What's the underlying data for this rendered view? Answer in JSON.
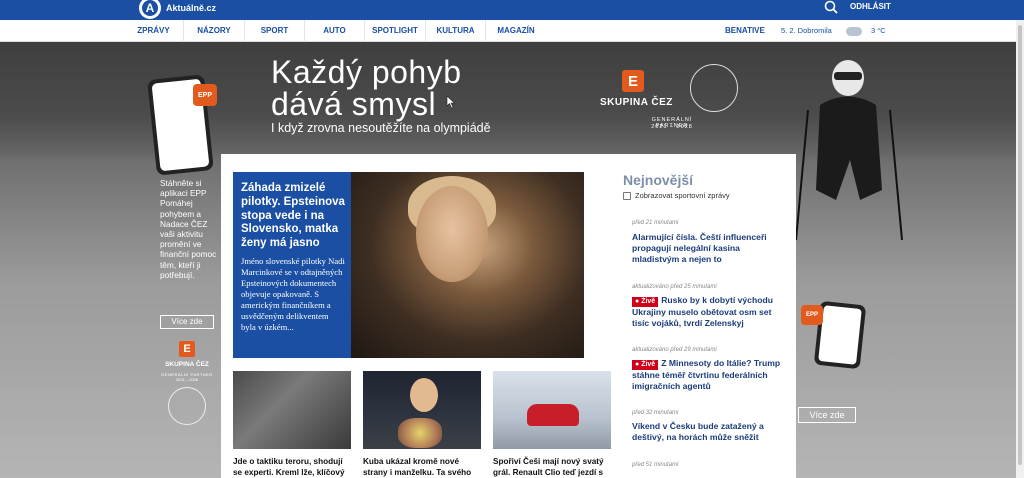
{
  "header": {
    "logo_letter": "A",
    "brand": "Aktuálně.cz",
    "logout": "ODHLÁSIT"
  },
  "nav": {
    "items": [
      "ZPRÁVY",
      "NÁZORY",
      "SPORT",
      "AUTO",
      "SPOTLIGHT",
      "KULTURA",
      "MAGAZÍN"
    ],
    "benative": "BENATIVE",
    "nameday": "5. 2. Dobromila",
    "weather": "3 °C"
  },
  "ad": {
    "headline_1": "Každý pohyb",
    "headline_2": "dává smysl",
    "subline": "I když zrovna nesoutěžíte na olympiádě",
    "cez_letter": "E",
    "cez_name": "SKUPINA ČEZ",
    "partner": "GENERÁLNÍ PARTNER",
    "years": "2021 – 2028",
    "epp": "EPP",
    "side_text": "Stáhněte si aplikaci EPP Pomáhej pohybem a Nadace ČEZ vaši aktivitu promění ve finanční pomoc těm, kteří ji potřebují.",
    "more_left": "Více zde",
    "more_right": "Více zde"
  },
  "featured": {
    "title": "Záhada zmizelé pilotky. Epsteinova stopa vede i na Slovensko, matka ženy má jasno",
    "body": "Jméno slovenské pilotky Nadi Marcinkové se v odtajněných Epsteinových dokumentech objevuje opakovaně. S americkým finančníkem a usvědčeným delikventem byla v úzkém..."
  },
  "thumbs": [
    {
      "caption": "Jde o taktiku teroru, shodují se experti. Kreml lže, klíčový cíl se"
    },
    {
      "caption": "Kuba ukázal kromě nové strany i manželku. Ta svého muže vidí"
    },
    {
      "caption": "Spořiví Češi mají nový svatý grál. Renault Clio teď jezdí s"
    }
  ],
  "latest": {
    "title": "Nejnovější",
    "checkbox_label": "Zobrazovat sportovní zprávy",
    "live_label": "Živě",
    "items": [
      {
        "time": "před 21 minutami",
        "title": "Alarmující čísla. Čeští influenceři propagují nelegální kasina mladistvým a nejen to",
        "live": false
      },
      {
        "time": "aktualizováno před 25 minutami",
        "title": "Rusko by k dobytí východu Ukrajiny muselo obětovat osm set tisíc vojáků, tvrdí Zelenskyj",
        "live": true
      },
      {
        "time": "aktualizováno před 29 minutami",
        "title": "Z Minnesoty do Itálie? Trump stáhne téměř čtvrtinu federálních imigračních agentů",
        "live": true
      },
      {
        "time": "před 32 minutami",
        "title": "Víkend v Česku bude zatažený a deštivý, na horách může sněžit",
        "live": false
      },
      {
        "time": "před 51 minutami",
        "title": "",
        "live": false
      }
    ]
  },
  "colors": {
    "brand_blue": "#1a4fa3",
    "cez_orange": "#e35a1e",
    "live_red": "#d0021b",
    "latest_title": "#7d8fa8"
  }
}
